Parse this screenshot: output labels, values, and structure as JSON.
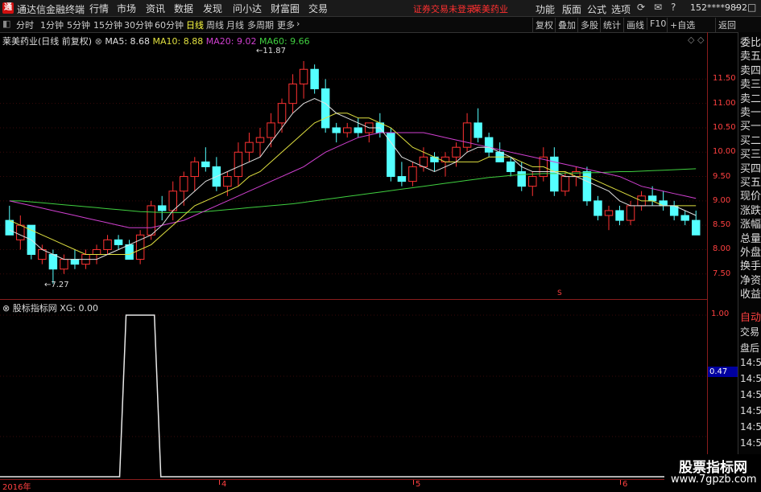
{
  "titlebar": {
    "logo": "通",
    "app_title": "通达信金融终端",
    "menus": [
      "行情",
      "市场",
      "资讯",
      "数据",
      "发现",
      "问小达",
      "财富圈",
      "交易"
    ],
    "warning": "证券交易未登录",
    "stock_name": "莱美药业",
    "right_menus": [
      "功能",
      "版面",
      "公式",
      "选项"
    ],
    "account": "152****9892"
  },
  "toolbar": {
    "periods": [
      "分时",
      "1分钟",
      "5分钟",
      "15分钟",
      "30分钟",
      "60分钟",
      "日线",
      "周线",
      "月线",
      "多周期",
      "更多"
    ],
    "active_period": "日线",
    "right_buttons": [
      "复权",
      "叠加",
      "多股",
      "统计",
      "画线",
      "F10",
      "+自选",
      "返回"
    ]
  },
  "main_chart": {
    "stock_label": "莱美药业(日线 前复权)",
    "ma5": "MA5: 8.68",
    "ma10": "MA10: 8.88",
    "ma20": "MA20: 9.02",
    "ma60": "MA60: 9.66",
    "high_label": "11.87",
    "low_label": "7.27",
    "price_ticks": [
      "11.50",
      "11.00",
      "10.50",
      "10.00",
      "9.50",
      "9.00",
      "8.50",
      "8.00",
      "7.50"
    ],
    "ylim": [
      7.1,
      12.1
    ],
    "marker": "S",
    "colors": {
      "up": "#ff3232",
      "down": "#54ffff",
      "ma5": "#e0e0e0",
      "ma10": "#e0e040",
      "ma20": "#d040d0",
      "ma60": "#40d040"
    }
  },
  "indicator": {
    "label": "股标指标网 XG: 0.00",
    "ticks": [
      "1.00",
      "0.47"
    ],
    "value_box": "0.47"
  },
  "bottom_axis": {
    "labels": [
      "2016年",
      "4",
      "5",
      "6"
    ]
  },
  "right_panel": {
    "items": [
      "委比",
      "卖五",
      "卖四",
      "卖三",
      "卖二",
      "卖一",
      "买一",
      "买二",
      "买三",
      "买四",
      "买五",
      "现价",
      "涨跌",
      "涨幅",
      "总量",
      "外盘",
      "换手",
      "净资",
      "收益"
    ],
    "auto_label": "自动",
    "lower_items": [
      "交易",
      "盘后",
      "14:5",
      "14:5",
      "14:5",
      "14:5",
      "14:5",
      "14:5",
      "14:5",
      "14:5"
    ]
  },
  "watermark": {
    "line1": "股票指标网",
    "line2": "www.7gpzb.com"
  },
  "chart_data": {
    "type": "candlestick",
    "title": "莱美药业(日线 前复权)",
    "series_name_hint": "daily candles",
    "candles": [
      [
        8.6,
        8.9,
        8.3,
        8.3
      ],
      [
        8.2,
        8.7,
        8.0,
        8.5
      ],
      [
        8.5,
        8.5,
        7.8,
        7.9
      ],
      [
        7.8,
        8.1,
        7.7,
        8.0
      ],
      [
        7.9,
        8.0,
        7.3,
        7.6
      ],
      [
        7.6,
        7.9,
        7.5,
        7.8
      ],
      [
        7.8,
        8.0,
        7.6,
        7.7
      ],
      [
        7.7,
        8.0,
        7.6,
        7.9
      ],
      [
        7.9,
        8.1,
        7.7,
        8.0
      ],
      [
        8.0,
        8.3,
        7.9,
        8.2
      ],
      [
        8.2,
        8.3,
        8.0,
        8.1
      ],
      [
        8.1,
        8.2,
        7.8,
        7.8
      ],
      [
        7.8,
        8.4,
        7.7,
        8.3
      ],
      [
        8.3,
        9.0,
        8.2,
        8.9
      ],
      [
        8.9,
        9.1,
        8.6,
        8.8
      ],
      [
        8.8,
        9.4,
        8.6,
        9.2
      ],
      [
        9.2,
        9.6,
        8.9,
        9.5
      ],
      [
        9.5,
        9.9,
        9.2,
        9.8
      ],
      [
        9.8,
        10.1,
        9.6,
        9.7
      ],
      [
        9.7,
        9.9,
        9.2,
        9.3
      ],
      [
        9.3,
        9.6,
        9.1,
        9.5
      ],
      [
        9.5,
        10.2,
        9.3,
        10.0
      ],
      [
        10.0,
        10.4,
        9.8,
        10.2
      ],
      [
        10.2,
        10.5,
        9.9,
        10.3
      ],
      [
        10.3,
        10.8,
        10.1,
        10.6
      ],
      [
        10.6,
        11.1,
        10.4,
        11.0
      ],
      [
        11.0,
        11.6,
        10.8,
        11.4
      ],
      [
        11.4,
        11.87,
        11.1,
        11.7
      ],
      [
        11.7,
        11.8,
        11.2,
        11.3
      ],
      [
        11.3,
        11.5,
        10.4,
        10.5
      ],
      [
        10.5,
        10.6,
        10.2,
        10.4
      ],
      [
        10.4,
        10.6,
        10.3,
        10.5
      ],
      [
        10.5,
        10.7,
        10.3,
        10.4
      ],
      [
        10.4,
        10.6,
        10.2,
        10.6
      ],
      [
        10.6,
        10.8,
        10.3,
        10.4
      ],
      [
        10.4,
        10.5,
        9.4,
        9.5
      ],
      [
        9.5,
        9.8,
        9.3,
        9.4
      ],
      [
        9.4,
        9.8,
        9.3,
        9.7
      ],
      [
        9.7,
        10.1,
        9.6,
        9.9
      ],
      [
        9.9,
        10.0,
        9.6,
        9.8
      ],
      [
        9.8,
        10.0,
        9.5,
        9.9
      ],
      [
        9.9,
        10.2,
        9.7,
        10.1
      ],
      [
        10.1,
        10.8,
        10.0,
        10.6
      ],
      [
        10.6,
        10.9,
        10.2,
        10.3
      ],
      [
        10.3,
        10.4,
        9.9,
        10.0
      ],
      [
        10.0,
        10.2,
        9.8,
        9.8
      ],
      [
        9.8,
        9.9,
        9.5,
        9.6
      ],
      [
        9.6,
        9.8,
        9.2,
        9.3
      ],
      [
        9.3,
        9.6,
        9.1,
        9.5
      ],
      [
        9.5,
        10.1,
        9.4,
        9.9
      ],
      [
        9.9,
        10.1,
        9.1,
        9.2
      ],
      [
        9.2,
        9.6,
        9.1,
        9.5
      ],
      [
        9.5,
        9.7,
        9.3,
        9.6
      ],
      [
        9.6,
        9.7,
        8.9,
        9.0
      ],
      [
        9.0,
        9.1,
        8.6,
        8.7
      ],
      [
        8.7,
        8.9,
        8.4,
        8.8
      ],
      [
        8.8,
        8.9,
        8.5,
        8.6
      ],
      [
        8.6,
        9.0,
        8.5,
        8.9
      ],
      [
        8.9,
        9.2,
        8.8,
        9.1
      ],
      [
        9.1,
        9.3,
        8.9,
        9.0
      ],
      [
        9.0,
        9.2,
        8.8,
        8.9
      ],
      [
        8.9,
        9.0,
        8.6,
        8.7
      ],
      [
        8.7,
        8.8,
        8.5,
        8.6
      ],
      [
        8.6,
        8.8,
        8.3,
        8.3
      ]
    ],
    "ma5": [
      8.4,
      8.3,
      8.2,
      8.0,
      7.9,
      7.8,
      7.8,
      7.8,
      7.8,
      7.9,
      8.0,
      8.1,
      8.2,
      8.3,
      8.5,
      8.8,
      9.0,
      9.2,
      9.4,
      9.5,
      9.6,
      9.7,
      9.8,
      9.9,
      10.2,
      10.5,
      10.8,
      11.0,
      11.1,
      11.0,
      10.8,
      10.7,
      10.6,
      10.5,
      10.5,
      10.2,
      9.9,
      9.8,
      9.7,
      9.6,
      9.7,
      9.8,
      10.0,
      10.1,
      10.1,
      10.0,
      9.9,
      9.7,
      9.6,
      9.6,
      9.6,
      9.5,
      9.5,
      9.4,
      9.3,
      9.2,
      9.0,
      8.9,
      8.9,
      8.9,
      8.9,
      8.9,
      8.8,
      8.7
    ],
    "ma10": [
      8.6,
      8.5,
      8.4,
      8.3,
      8.2,
      8.1,
      8.0,
      7.9,
      7.9,
      7.9,
      7.9,
      7.9,
      8.0,
      8.1,
      8.3,
      8.5,
      8.7,
      8.9,
      9.0,
      9.1,
      9.2,
      9.3,
      9.5,
      9.6,
      9.8,
      10.0,
      10.2,
      10.4,
      10.6,
      10.7,
      10.8,
      10.8,
      10.7,
      10.7,
      10.6,
      10.5,
      10.3,
      10.1,
      10.0,
      9.9,
      9.8,
      9.8,
      9.8,
      9.8,
      9.9,
      9.9,
      9.9,
      9.8,
      9.7,
      9.7,
      9.6,
      9.6,
      9.5,
      9.5,
      9.4,
      9.3,
      9.2,
      9.1,
      9.0,
      9.0,
      8.9,
      8.9,
      8.9,
      8.9
    ],
    "ma20": [
      9.0,
      8.95,
      8.9,
      8.85,
      8.8,
      8.75,
      8.7,
      8.65,
      8.6,
      8.55,
      8.5,
      8.45,
      8.45,
      8.45,
      8.5,
      8.55,
      8.6,
      8.7,
      8.8,
      8.9,
      9.0,
      9.1,
      9.2,
      9.3,
      9.4,
      9.5,
      9.6,
      9.7,
      9.85,
      10.0,
      10.1,
      10.2,
      10.3,
      10.35,
      10.4,
      10.4,
      10.4,
      10.4,
      10.4,
      10.35,
      10.3,
      10.25,
      10.2,
      10.15,
      10.1,
      10.05,
      10.0,
      9.95,
      9.9,
      9.85,
      9.8,
      9.75,
      9.7,
      9.65,
      9.6,
      9.55,
      9.5,
      9.4,
      9.3,
      9.25,
      9.2,
      9.15,
      9.1,
      9.05
    ],
    "ma60": [
      9.0,
      9.0,
      8.98,
      8.96,
      8.94,
      8.92,
      8.9,
      8.88,
      8.86,
      8.84,
      8.82,
      8.8,
      8.78,
      8.77,
      8.76,
      8.76,
      8.76,
      8.77,
      8.78,
      8.8,
      8.82,
      8.84,
      8.86,
      8.88,
      8.9,
      8.92,
      8.94,
      8.97,
      9.0,
      9.03,
      9.06,
      9.09,
      9.12,
      9.15,
      9.18,
      9.21,
      9.24,
      9.27,
      9.3,
      9.33,
      9.36,
      9.39,
      9.42,
      9.45,
      9.48,
      9.5,
      9.52,
      9.54,
      9.55,
      9.56,
      9.56,
      9.57,
      9.57,
      9.58,
      9.58,
      9.59,
      9.6,
      9.6,
      9.61,
      9.62,
      9.63,
      9.64,
      9.65,
      9.66
    ],
    "xg_signal_range": [
      11,
      13
    ]
  }
}
